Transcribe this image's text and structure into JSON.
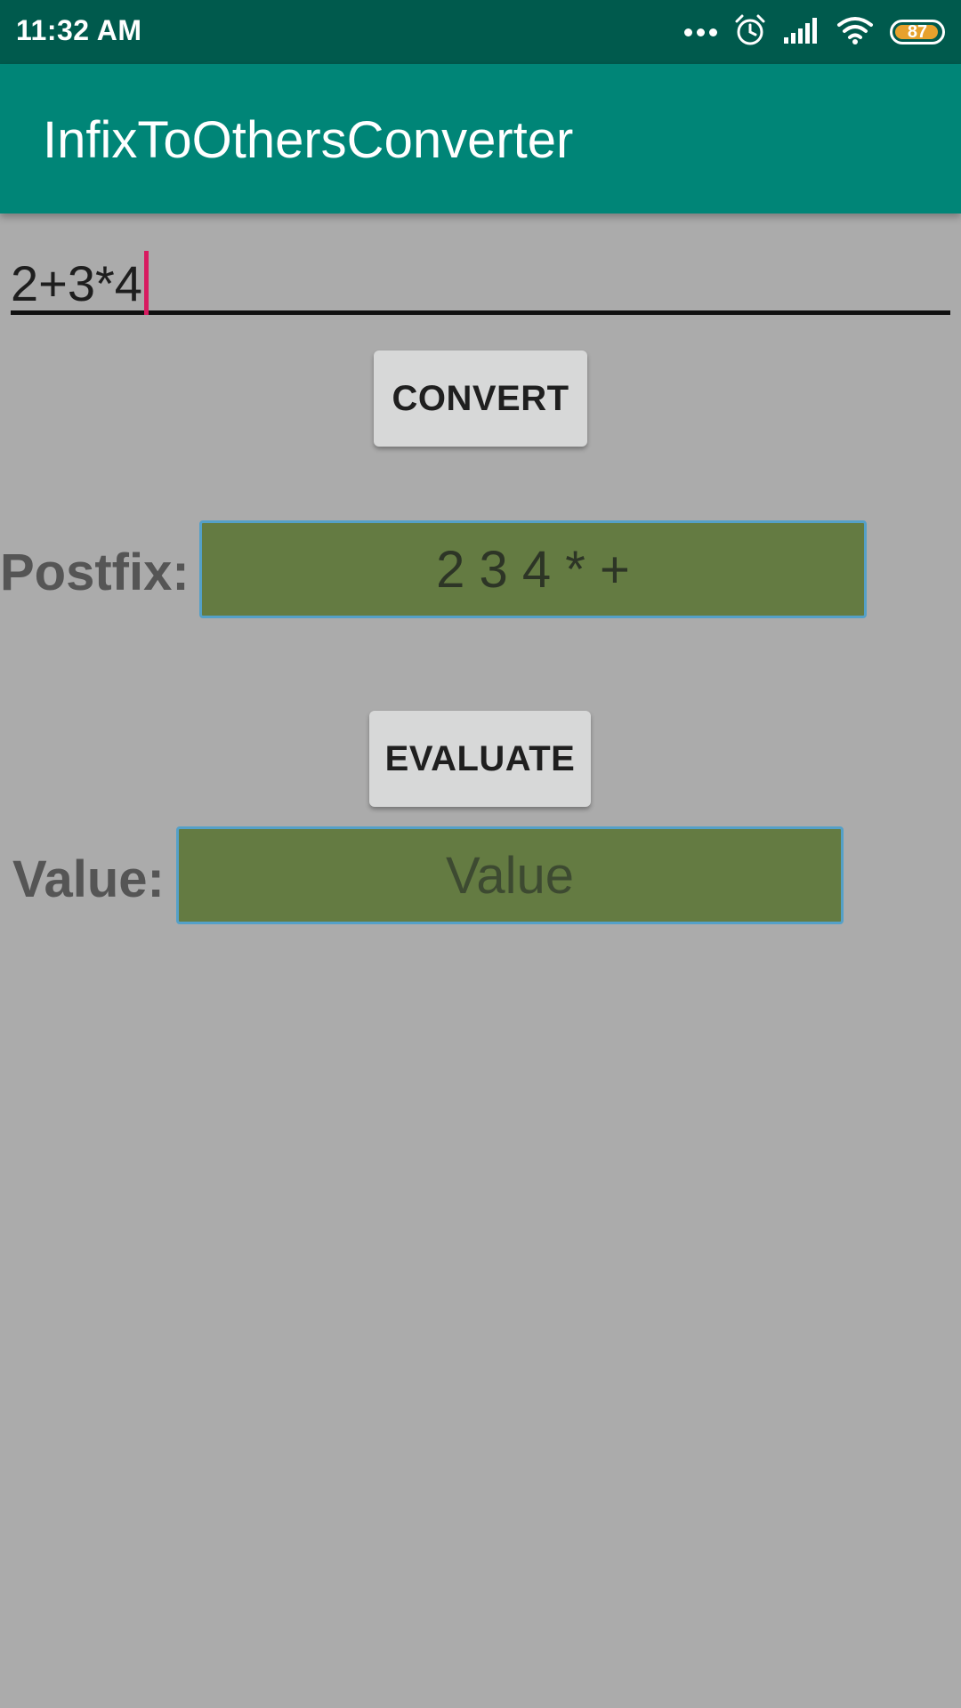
{
  "status_bar": {
    "time": "11:32 AM",
    "battery": "87",
    "icons": [
      "more-dots-icon",
      "alarm-icon",
      "signal-icon",
      "wifi-icon",
      "battery-icon"
    ]
  },
  "app_bar": {
    "title": "InfixToOthersConverter"
  },
  "infix_input": {
    "value": "2+3*4"
  },
  "convert_button": {
    "label": "CONVERT"
  },
  "postfix": {
    "label": "Postfix:",
    "value": "2 3 4 * +"
  },
  "evaluate_button": {
    "label": "EVALUATE"
  },
  "value": {
    "label": "Value:",
    "placeholder": "Value"
  },
  "colors": {
    "status_bar": "#005a4d",
    "app_bar": "#008577",
    "background": "#ababab",
    "output_box": "#647b42",
    "output_border": "#54a0c8",
    "cursor": "#d81b60",
    "battery_fill": "#e7a12d"
  }
}
